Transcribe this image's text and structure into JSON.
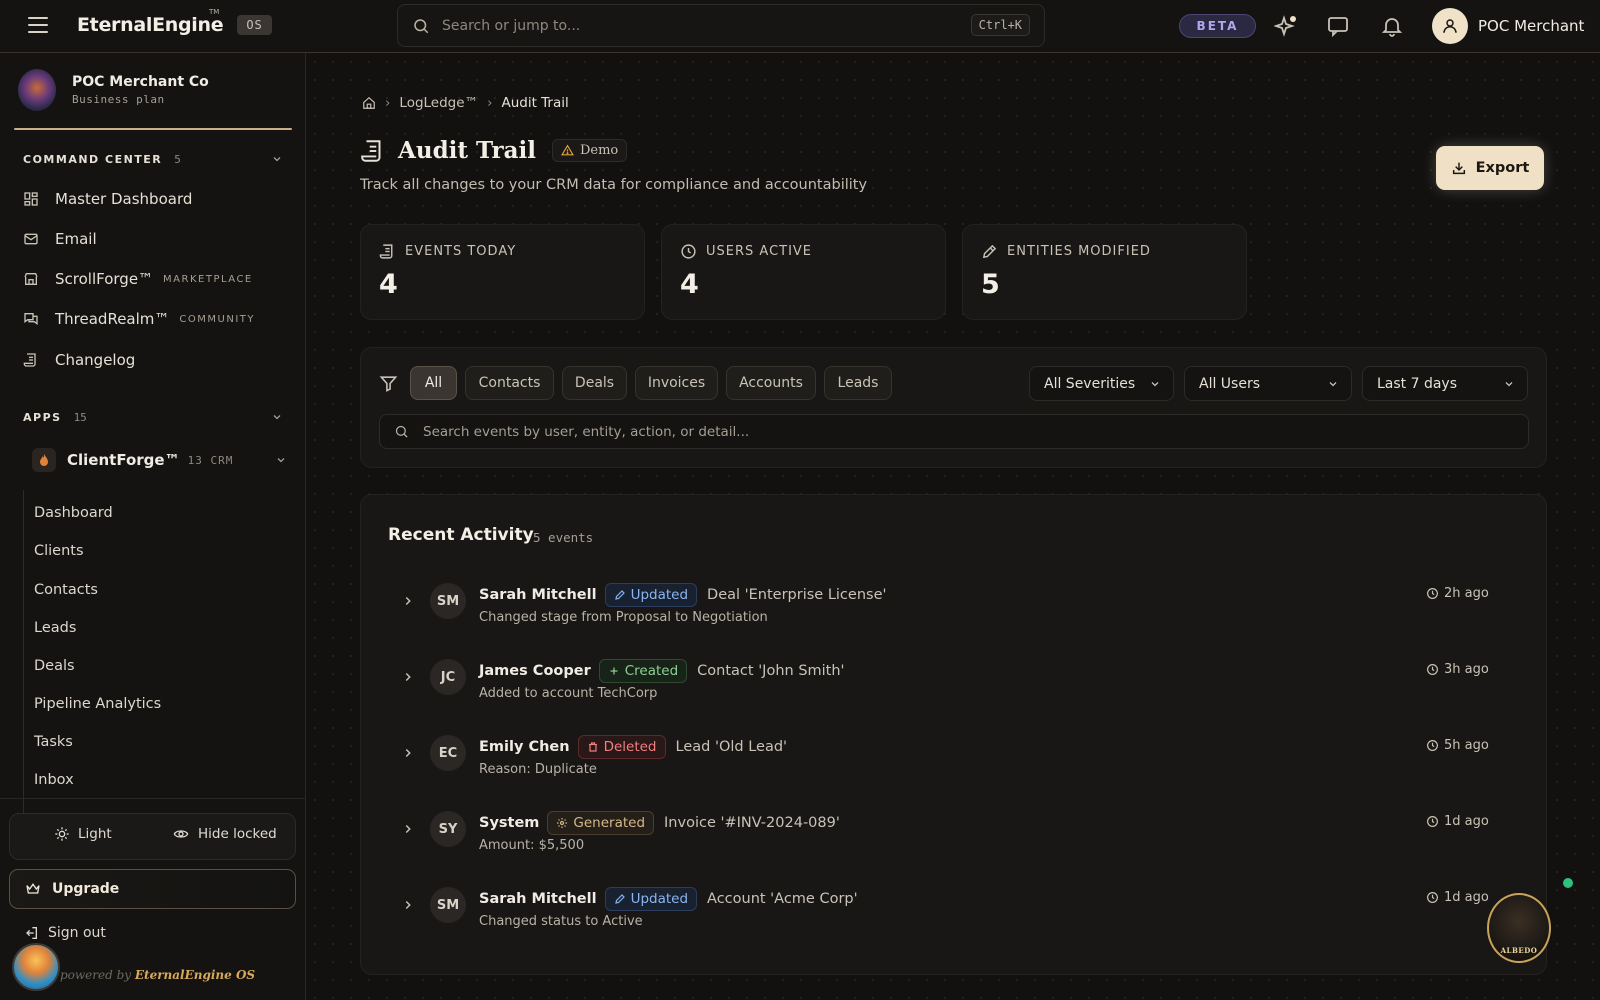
{
  "topbar": {
    "brand": "EternalEngine",
    "brand_tm": "TM",
    "os_badge": "OS",
    "search_placeholder": "Search or jump to...",
    "search_shortcut": "Ctrl+K",
    "beta": "BETA",
    "user_name": "POC Merchant"
  },
  "sidebar": {
    "org_name": "POC Merchant Co",
    "org_plan": "Business plan",
    "command_center": {
      "title": "COMMAND CENTER",
      "count": "5"
    },
    "nav": [
      {
        "label": "Master Dashboard",
        "tag": ""
      },
      {
        "label": "Email",
        "tag": ""
      },
      {
        "label": "ScrollForge™",
        "tag": "MARKETPLACE"
      },
      {
        "label": "ThreadRealm™",
        "tag": "COMMUNITY"
      },
      {
        "label": "Changelog",
        "tag": ""
      }
    ],
    "apps": {
      "title": "APPS",
      "count": "15"
    },
    "app": {
      "name": "ClientForge™",
      "meta": "13 CRM"
    },
    "sub_items": [
      "Dashboard",
      "Clients",
      "Contacts",
      "Leads",
      "Deals",
      "Pipeline Analytics",
      "Tasks",
      "Inbox"
    ],
    "light_label": "Light",
    "hide_locked_label": "Hide locked",
    "upgrade_label": "Upgrade",
    "signout_label": "Sign out",
    "powered_prefix": "powered by",
    "powered_brand": "EternalEngine OS"
  },
  "main": {
    "breadcrumb": [
      "LogLedge™",
      "Audit Trail"
    ],
    "title": "Audit Trail",
    "demo_badge": "Demo",
    "subtitle": "Track all changes to your CRM data for compliance and accountability",
    "export_label": "Export",
    "stats": [
      {
        "label": "EVENTS TODAY",
        "value": "4",
        "icon": "scroll-icon"
      },
      {
        "label": "USERS ACTIVE",
        "value": "4",
        "icon": "clock-icon"
      },
      {
        "label": "ENTITIES MODIFIED",
        "value": "5",
        "icon": "pencil-icon"
      }
    ],
    "filter_chips": [
      "All",
      "Contacts",
      "Deals",
      "Invoices",
      "Accounts",
      "Leads"
    ],
    "active_chip": "All",
    "severity_select": "All Severities",
    "user_select": "All Users",
    "range_select": "Last 7 days",
    "event_search_placeholder": "Search events by user, entity, action, or detail..."
  },
  "activity": {
    "title": "Recent Activity",
    "count": "5 events",
    "events": [
      {
        "initials": "SM",
        "user": "Sarah Mitchell",
        "action": "Updated",
        "kind": "updated",
        "entity": "Deal 'Enterprise License'",
        "detail": "Changed stage from Proposal to Negotiation",
        "time": "2h ago"
      },
      {
        "initials": "JC",
        "user": "James Cooper",
        "action": "Created",
        "kind": "created",
        "entity": "Contact 'John Smith'",
        "detail": "Added to account TechCorp",
        "time": "3h ago"
      },
      {
        "initials": "EC",
        "user": "Emily Chen",
        "action": "Deleted",
        "kind": "deleted",
        "entity": "Lead 'Old Lead'",
        "detail": "Reason: Duplicate",
        "time": "5h ago"
      },
      {
        "initials": "SY",
        "user": "System",
        "action": "Generated",
        "kind": "generated",
        "entity": "Invoice '#INV-2024-089'",
        "detail": "Amount: $5,500",
        "time": "1d ago"
      },
      {
        "initials": "SM",
        "user": "Sarah Mitchell",
        "action": "Updated",
        "kind": "updated",
        "entity": "Account 'Acme Corp'",
        "detail": "Changed status to Active",
        "time": "1d ago"
      }
    ]
  },
  "assistant_label": "ALBEDO",
  "colors": {
    "accent": "#efe0c6",
    "updated": "#8ab4f0",
    "created": "#8fcf92",
    "deleted": "#f07f7f",
    "generated": "#d6b88a",
    "online": "#2ec27e"
  }
}
